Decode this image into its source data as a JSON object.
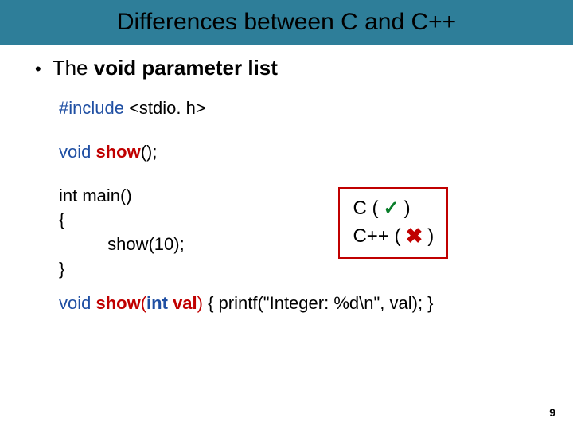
{
  "title": "Differences between C and C++",
  "bullet": {
    "dot": "•",
    "prefix": "The ",
    "keyword": "void parameter list"
  },
  "code": {
    "include_kw": "#include",
    "include_rest": " <stdio. h>",
    "decl_void": "void",
    "decl_show": "show",
    "decl_rest": "();",
    "main1": "int main()",
    "main2": "{",
    "main3_indent": "          ",
    "main3_call": "show(10);",
    "main4": "}",
    "def_void": "void",
    "def_show": "show",
    "def_paren_open": "(",
    "def_int": "int",
    "def_space": " ",
    "def_val": "val",
    "def_paren_close": ")",
    "def_body": " { printf(\"Integer: %d\\n\", val); }"
  },
  "result": {
    "c_label": "C  (",
    "c_mark": "✓",
    "c_close": ")",
    "cpp_label": "C++ (",
    "cpp_mark": "✖",
    "cpp_close": ")"
  },
  "page": "9"
}
